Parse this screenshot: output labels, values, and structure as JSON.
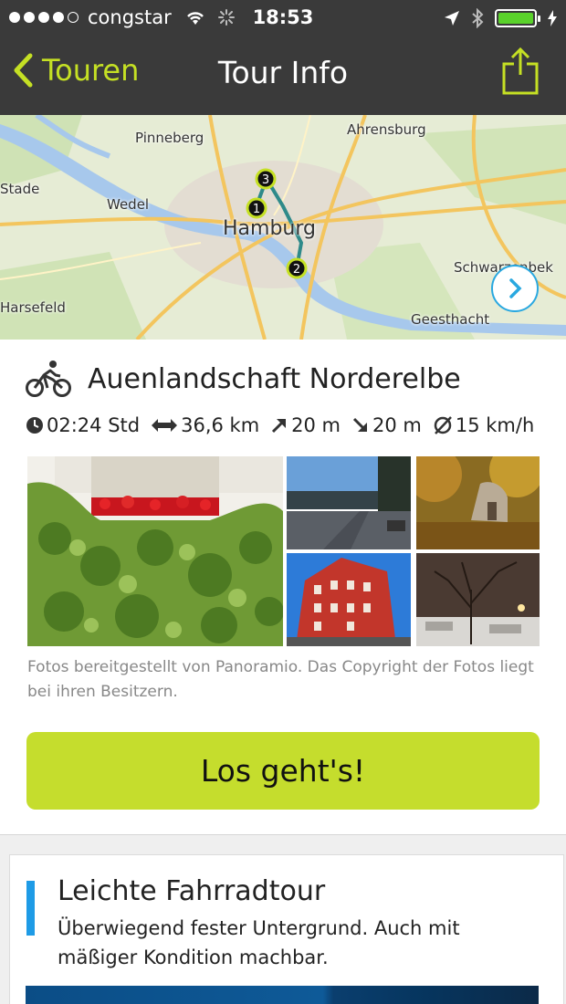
{
  "status_bar": {
    "carrier": "congstar",
    "time": "18:53"
  },
  "nav": {
    "back_label": "Touren",
    "title": "Tour Info",
    "accent_color": "#c5e024"
  },
  "map": {
    "places": {
      "pinneberg": "Pinneberg",
      "ahrensburg": "Ahrensburg",
      "stade": "Stade",
      "wedel": "Wedel",
      "hamburg": "Hamburg",
      "schwarzenbek": "Schwarzenbek",
      "harsefeld": "Harsefeld",
      "geesthacht": "Geesthacht"
    },
    "markers": [
      "1",
      "2",
      "3"
    ]
  },
  "tour": {
    "title": "Auenlandschaft Norderelbe",
    "duration": "02:24 Std",
    "distance": "36,6 km",
    "ascent": "20 m",
    "descent": "20 m",
    "avg_speed": "15 km/h",
    "photo_caption": "Fotos bereitgestellt von Panoramio. Das Copyright der Fotos liegt bei ihren Besitzern.",
    "start_button": "Los geht's!"
  },
  "level": {
    "title": "Leichte Fahrradtour",
    "description": "Überwiegend fester Untergrund. Auch mit mäßiger Kondition machbar.",
    "color": "#1e9be6"
  }
}
